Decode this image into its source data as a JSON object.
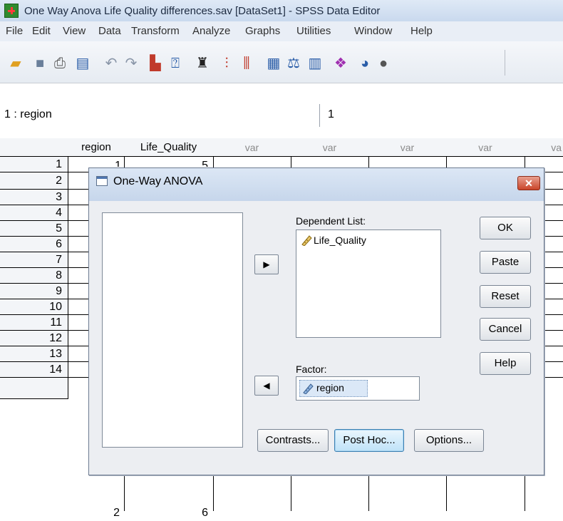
{
  "window": {
    "title": "One Way Anova Life Quality differences.sav [DataSet1] - SPSS Data Editor"
  },
  "menu": {
    "items": [
      "File",
      "Edit",
      "View",
      "Data",
      "Transform",
      "Analyze",
      "Graphs",
      "Utilities",
      "Window",
      "Help"
    ]
  },
  "toolbar": {
    "icons": [
      "open-folder-icon",
      "save-icon",
      "print-icon",
      "dialog-recall-icon",
      "undo-icon",
      "redo-icon",
      "goto-case-icon",
      "variables-icon",
      "find-icon",
      "insert-cases-icon",
      "insert-variable-icon",
      "split-file-icon",
      "weight-cases-icon",
      "select-cases-icon",
      "value-labels-icon",
      "use-variable-sets-icon",
      "show-all-variables-icon"
    ]
  },
  "cell_ref": {
    "name": "1 : region",
    "value": "1"
  },
  "grid": {
    "columns": [
      "region",
      "Life_Quality",
      "var",
      "var",
      "var",
      "var",
      "va"
    ],
    "row_numbers": [
      "1",
      "2",
      "3",
      "4",
      "5",
      "6",
      "7",
      "8",
      "9",
      "10",
      "11",
      "12",
      "13",
      "14"
    ],
    "visible_cells": {
      "row1_region": "1",
      "row1_life": "5",
      "row14_region": "2",
      "row14_life": "6"
    }
  },
  "dialog": {
    "title": "One-Way ANOVA",
    "close": "✕",
    "dependent_label": "Dependent List:",
    "dependent_items": [
      "Life_Quality"
    ],
    "factor_label": "Factor:",
    "factor_value": "region",
    "move_right": "▶",
    "move_left": "◀",
    "buttons": {
      "ok": "OK",
      "paste": "Paste",
      "reset": "Reset",
      "cancel": "Cancel",
      "help": "Help"
    },
    "bottom_buttons": {
      "contrasts": "Contrasts...",
      "posthoc": "Post Hoc...",
      "options": "Options..."
    }
  }
}
